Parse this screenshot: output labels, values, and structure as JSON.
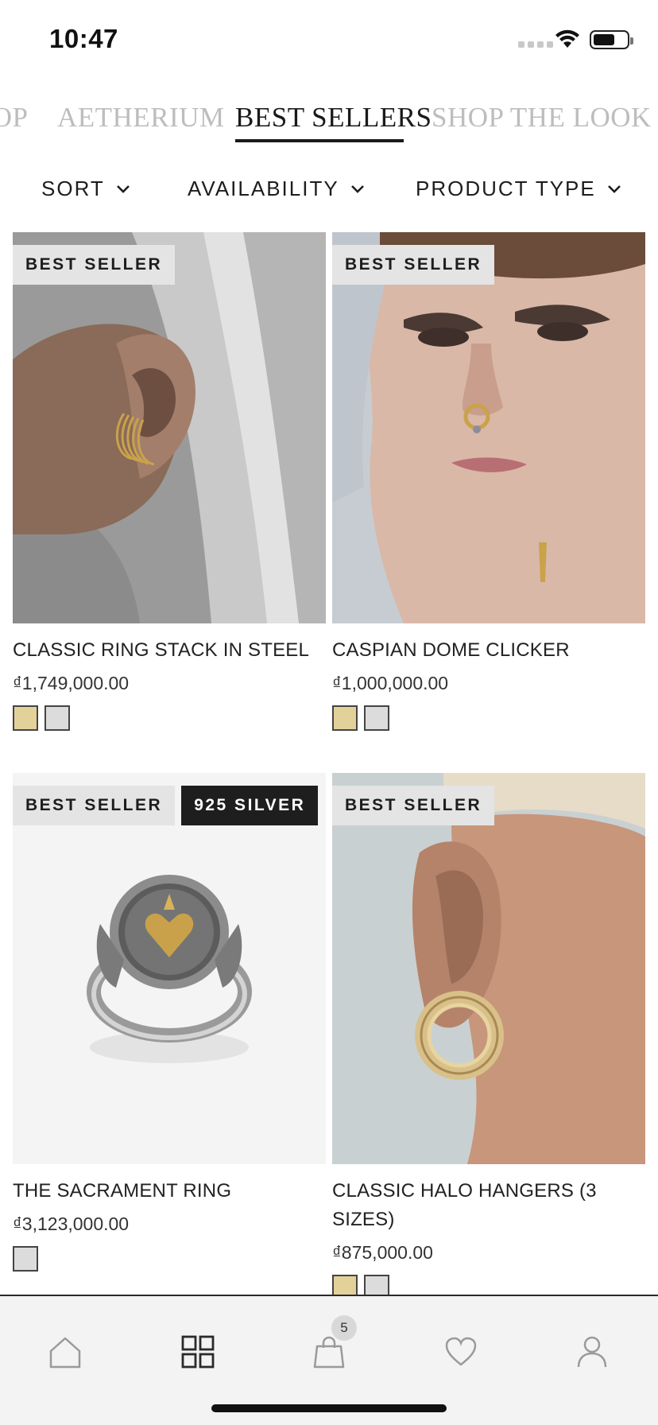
{
  "status_bar": {
    "time": "10:47"
  },
  "category_tabs": [
    {
      "label": "SHOP"
    },
    {
      "label": "AETHERIUM"
    },
    {
      "label": "BEST SELLERS",
      "active": true
    },
    {
      "label": "SHOP THE LOOK"
    }
  ],
  "filters": [
    {
      "label": "SORT"
    },
    {
      "label": "AVAILABILITY"
    },
    {
      "label": "PRODUCT TYPE"
    }
  ],
  "products": [
    {
      "title": "CLASSIC RING STACK IN STEEL",
      "price": "₫1,749,000.00",
      "badges": [
        "BEST SELLER"
      ],
      "swatches": [
        "gold",
        "silver"
      ],
      "image": "earring-gray-hair"
    },
    {
      "title": "CASPIAN DOME CLICKER",
      "price": "₫1,000,000.00",
      "badges": [
        "BEST SELLER"
      ],
      "swatches": [
        "gold",
        "silver"
      ],
      "image": "septum-ring-face"
    },
    {
      "title": "THE SACRAMENT RING",
      "price": "₫3,123,000.00",
      "badges": [
        "BEST SELLER",
        "925 SILVER"
      ],
      "swatches": [
        "silver"
      ],
      "image": "silver-heart-ring"
    },
    {
      "title": "CLASSIC HALO HANGERS (3 SIZES)",
      "price": "₫875,000.00",
      "badges": [
        "BEST SELLER"
      ],
      "swatches": [
        "gold",
        "silver"
      ],
      "image": "gold-hoop-ear"
    }
  ],
  "tab_bar": {
    "items": [
      {
        "icon": "home-icon"
      },
      {
        "icon": "grid-icon"
      },
      {
        "icon": "bag-icon"
      },
      {
        "icon": "heart-icon"
      },
      {
        "icon": "user-icon"
      }
    ],
    "cart_count": "5"
  },
  "colors": {
    "gold_swatch": "#e3d19a",
    "silver_swatch": "#dcdcdc",
    "accent": "#1a1a1a"
  }
}
